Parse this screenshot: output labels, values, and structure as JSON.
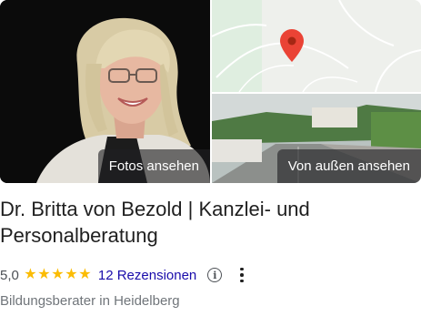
{
  "photos": {
    "main_button_label": "Fotos ansehen",
    "street_button_label": "Von außen ansehen"
  },
  "business": {
    "name": "Dr. Britta von Bezold | Kanzlei- und Personalberatung",
    "rating": "5,0",
    "star_count": 5,
    "reviews_label": "12 Rezensionen",
    "category": "Bildungsberater in Heidelberg"
  },
  "colors": {
    "star": "#fbbc04",
    "link": "#1a0dab",
    "map_pin": "#ea4335"
  },
  "icons": {
    "info": "info-circle-icon",
    "more": "more-vertical-icon",
    "pin": "map-pin-icon"
  }
}
